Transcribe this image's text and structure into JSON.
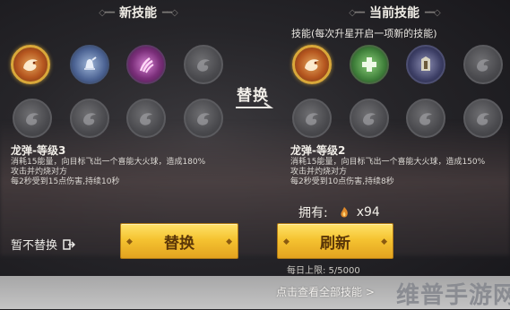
{
  "new_skills": {
    "title": "新技能",
    "skill_name": "龙弹-等级3",
    "description": [
      "消耗15能量，向目标飞出一个喜能大火球，造成180%",
      "攻击并灼烧对方",
      "每2秒受到15点伤害,持续10秒"
    ],
    "slots": [
      "dragon-skill-icon",
      "bell-skill-icon",
      "claw-skill-icon",
      "empty-slot",
      "empty-slot",
      "empty-slot",
      "empty-slot",
      "empty-slot"
    ]
  },
  "current_skills": {
    "title": "当前技能",
    "hint": "技能(每次升星开启一项新的技能)",
    "skill_name": "龙弹-等级2",
    "description": [
      "消耗15能量，向目标飞出一个喜能大火球，造成150%",
      "攻击并灼烧对方",
      "每2秒受到10点伤害,持续8秒"
    ],
    "slots": [
      "dragon-skill-icon",
      "heal-skill-icon",
      "armor-skill-icon",
      "empty-slot",
      "empty-slot",
      "empty-slot",
      "empty-slot",
      "empty-slot"
    ]
  },
  "swap": {
    "label": "替换"
  },
  "owned": {
    "label": "拥有:",
    "count": "x94"
  },
  "buttons": {
    "replace": "替换",
    "refresh": "刷新",
    "no_replace": "暂不替换"
  },
  "daily_limit": "每日上限: 5/5000",
  "view_all": "点击查看全部技能 >",
  "watermark": "维普手游网",
  "colors": {
    "button_gold": "#f5c331",
    "button_text": "#5a3608",
    "border_gold": "#d9a83a"
  }
}
